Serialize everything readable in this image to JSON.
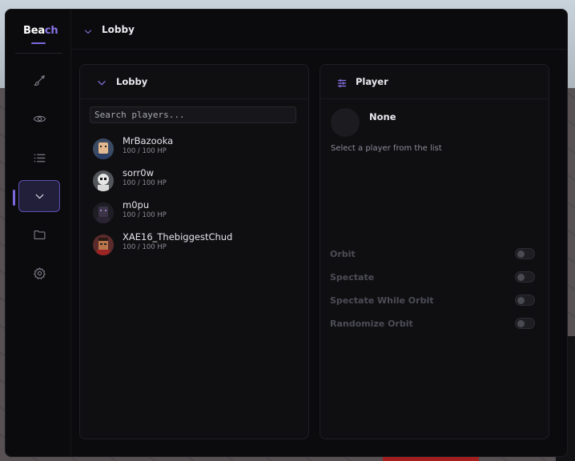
{
  "app": {
    "brand_prefix": "Bea",
    "brand_suffix": "ch",
    "accent": "#8b74e8"
  },
  "topbar": {
    "title": "Lobby"
  },
  "sidebar": {
    "items": [
      {
        "icon": "brush-icon"
      },
      {
        "icon": "eye-icon"
      },
      {
        "icon": "list-icon"
      },
      {
        "icon": "chevron-down-icon",
        "active": true
      },
      {
        "icon": "folder-icon"
      },
      {
        "icon": "gear-icon"
      }
    ]
  },
  "lobby": {
    "title": "Lobby",
    "search_placeholder": "Search players...",
    "players": [
      {
        "name": "MrBazooka",
        "hp": "100 / 100 HP"
      },
      {
        "name": "sorr0w",
        "hp": "100 / 100 HP"
      },
      {
        "name": "m0pu",
        "hp": "100 / 100 HP"
      },
      {
        "name": "XAE16_ThebiggestChud",
        "hp": "100 / 100 HP"
      }
    ]
  },
  "player": {
    "title": "Player",
    "selected_name": "None",
    "hint": "Select a player from the list",
    "toggles": [
      {
        "label": "Orbit",
        "on": false
      },
      {
        "label": "Spectate",
        "on": false
      },
      {
        "label": "Spectate While Orbit",
        "on": false
      },
      {
        "label": "Randomize Orbit",
        "on": false
      }
    ]
  }
}
